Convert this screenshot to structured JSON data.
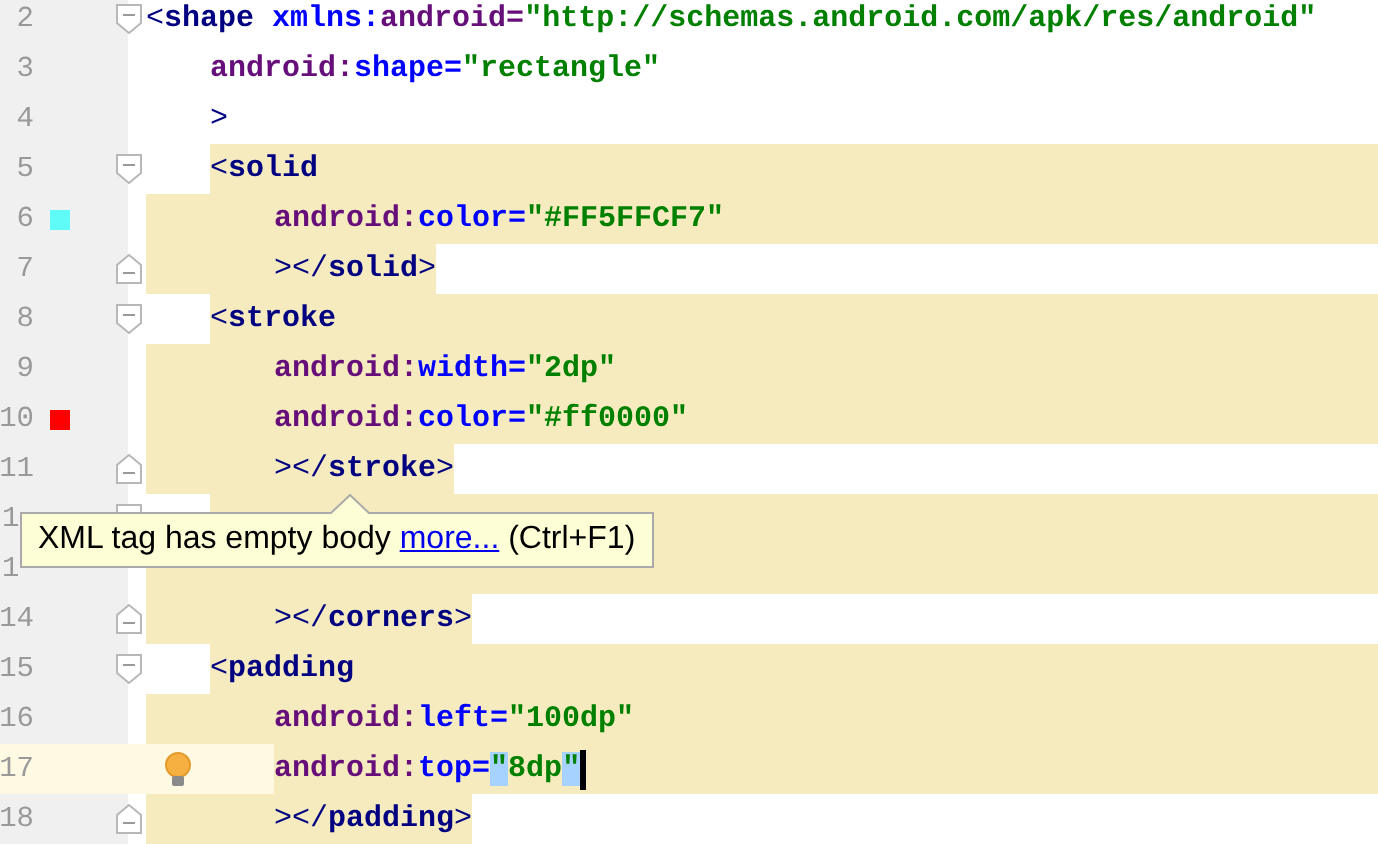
{
  "lines": [
    {
      "number": "2",
      "fold_start": true,
      "kind": "plain",
      "tokens": [
        {
          "t": "<",
          "kind": "bracket"
        },
        {
          "t": "shape",
          "kind": "tag"
        },
        {
          "t": " xmlns:",
          "kind": "attr"
        },
        {
          "t": "android=",
          "kind": "ns"
        },
        {
          "t": "\"http://schemas.android.com/apk/res/android\"",
          "kind": "value"
        }
      ],
      "children": [
        {
          "number": "3",
          "kind": "plain",
          "tokens": [
            {
              "t": "android:",
              "kind": "ns"
            },
            {
              "t": "shape=",
              "kind": "attr"
            },
            {
              "t": "\"rectangle\"",
              "kind": "value"
            }
          ]
        },
        {
          "number": "4",
          "kind": "plain",
          "tokens": [
            {
              "t": ">",
              "kind": "bracket"
            }
          ]
        },
        {
          "number": "5",
          "fold_start": true,
          "kind": "block-open",
          "tokens": [
            {
              "t": "<",
              "kind": "bracket"
            },
            {
              "t": "solid",
              "kind": "tag"
            }
          ],
          "children": [
            {
              "number": "6",
              "color": "#5ffcf7",
              "kind": "block-body",
              "tokens": [
                {
                  "t": "android:",
                  "kind": "ns"
                },
                {
                  "t": "color=",
                  "kind": "attr"
                },
                {
                  "t": "\"#FF5FFCF7\"",
                  "kind": "value"
                }
              ]
            },
            {
              "number": "7",
              "fold_end": true,
              "kind": "block-close",
              "tokens": [
                {
                  "t": "></",
                  "kind": "bracket"
                },
                {
                  "t": "solid",
                  "kind": "tag"
                },
                {
                  "t": ">",
                  "kind": "bracket"
                }
              ]
            }
          ]
        },
        {
          "number": "8",
          "fold_start": true,
          "kind": "block-open",
          "tokens": [
            {
              "t": "<",
              "kind": "bracket"
            },
            {
              "t": "stroke",
              "kind": "tag"
            }
          ],
          "children": [
            {
              "number": "9",
              "kind": "block-body",
              "tokens": [
                {
                  "t": "android:",
                  "kind": "ns"
                },
                {
                  "t": "width=",
                  "kind": "attr"
                },
                {
                  "t": "\"2dp\"",
                  "kind": "value"
                }
              ]
            },
            {
              "number": "10",
              "color": "#ff0000",
              "kind": "block-body",
              "tokens": [
                {
                  "t": "android:",
                  "kind": "ns"
                },
                {
                  "t": "color=",
                  "kind": "attr"
                },
                {
                  "t": "\"#ff0000\"",
                  "kind": "value"
                }
              ]
            },
            {
              "number": "11",
              "fold_end": true,
              "kind": "block-close",
              "tokens": [
                {
                  "t": "></",
                  "kind": "bracket"
                },
                {
                  "t": "stroke",
                  "kind": "tag"
                },
                {
                  "t": ">",
                  "kind": "bracket"
                }
              ]
            }
          ]
        },
        {
          "number": "1",
          "covered": true,
          "fold_start": true,
          "kind": "block-open",
          "children": [
            {
              "number": "1",
              "covered": true,
              "kind": "block-body"
            },
            {
              "number": "14",
              "fold_end": true,
              "kind": "block-close",
              "tokens": [
                {
                  "t": "></",
                  "kind": "bracket"
                },
                {
                  "t": "corners",
                  "kind": "tag"
                },
                {
                  "t": ">",
                  "kind": "bracket"
                }
              ]
            }
          ]
        },
        {
          "number": "15",
          "fold_start": true,
          "kind": "block-open",
          "tokens": [
            {
              "t": "<",
              "kind": "bracket"
            },
            {
              "t": "padding",
              "kind": "tag"
            }
          ],
          "children": [
            {
              "number": "16",
              "kind": "block-body",
              "tokens": [
                {
                  "t": "android:",
                  "kind": "ns"
                },
                {
                  "t": "left=",
                  "kind": "attr"
                },
                {
                  "t": "\"100dp\"",
                  "kind": "value"
                }
              ]
            },
            {
              "number": "17",
              "current": true,
              "bulb": true,
              "caret": true,
              "kind": "block-body",
              "tokens": [
                {
                  "t": "android:",
                  "kind": "ns"
                },
                {
                  "t": "top=",
                  "kind": "attr"
                },
                {
                  "t": "\"",
                  "kind": "selected-value"
                },
                {
                  "t": "8dp",
                  "kind": "value"
                },
                {
                  "t": "\"",
                  "kind": "selected-value"
                }
              ]
            },
            {
              "number": "18",
              "fold_end": true,
              "kind": "block-close",
              "tokens": [
                {
                  "t": "></",
                  "kind": "bracket"
                },
                {
                  "t": "padding",
                  "kind": "tag"
                },
                {
                  "t": ">",
                  "kind": "bracket"
                }
              ]
            }
          ]
        }
      ]
    }
  ],
  "tooltip": {
    "before": "XML tag has empty body ",
    "link": "more...",
    "after": " (Ctrl+F1)"
  }
}
